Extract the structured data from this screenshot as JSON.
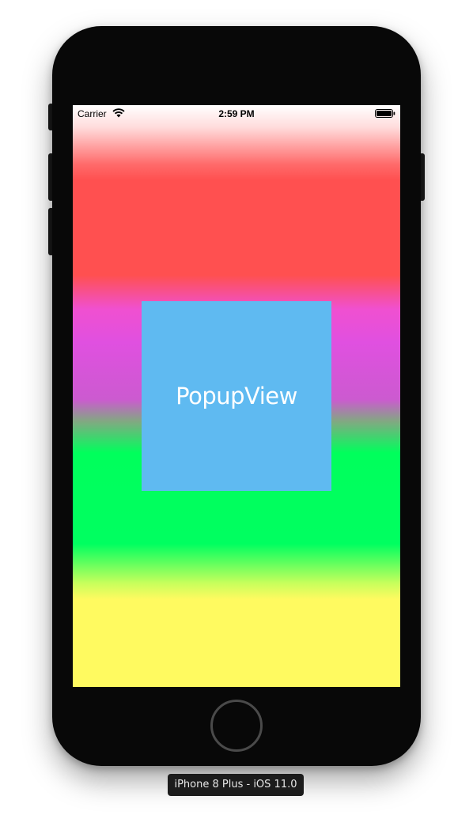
{
  "status_bar": {
    "carrier": "Carrier",
    "time": "2:59 PM",
    "wifi_icon": "wifi-icon",
    "battery_icon": "battery-icon"
  },
  "popup": {
    "label": "PopupView",
    "color": "#5fbaf1"
  },
  "background_gradient": {
    "colors": [
      "#ffffff",
      "#ff5050",
      "#e050e0",
      "#00ff60",
      "#fffa60"
    ]
  },
  "simulator": {
    "device_label": "iPhone 8 Plus - iOS 11.0",
    "home_button_icon": "home-button"
  }
}
